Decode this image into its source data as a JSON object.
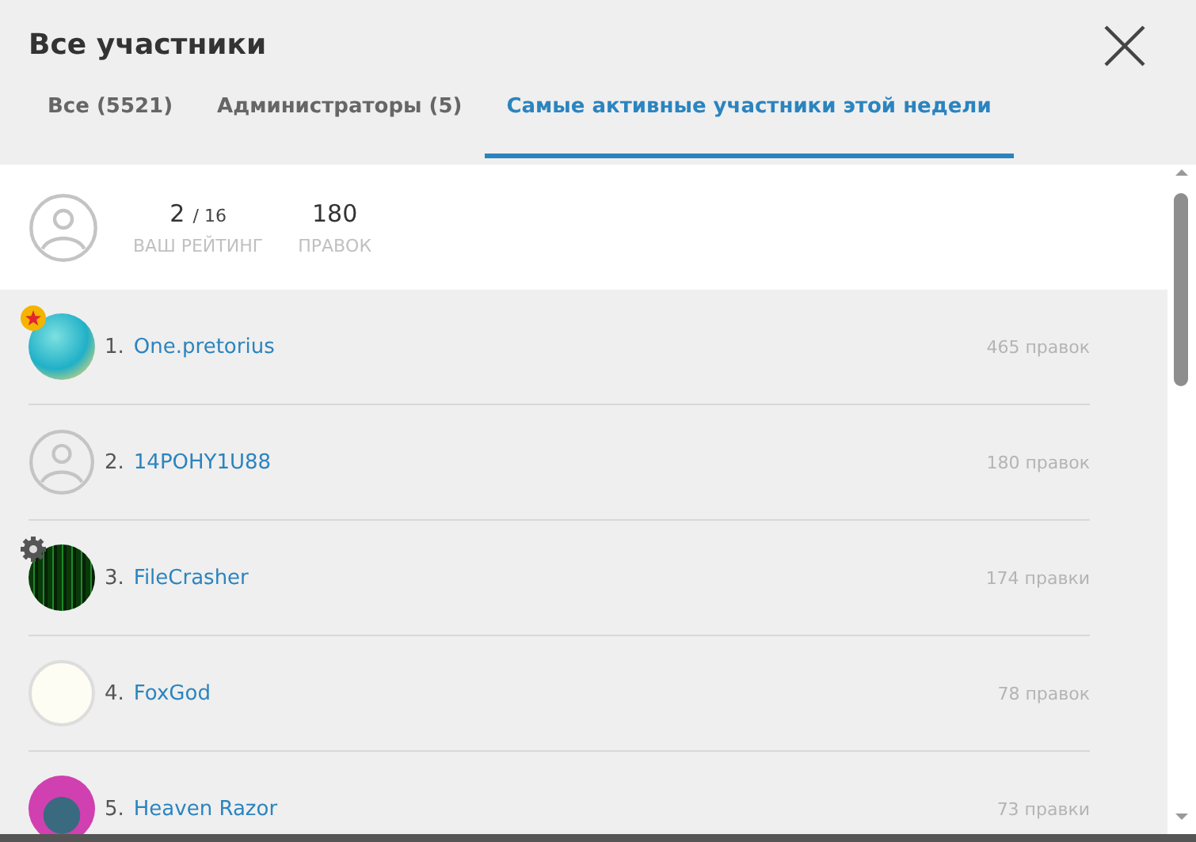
{
  "title": "Все участники",
  "tabs": [
    {
      "label": "Все (5521)",
      "selected": false
    },
    {
      "label": "Администраторы (5)",
      "selected": false
    },
    {
      "label": "Самые активные участники этой недели",
      "selected": true
    }
  ],
  "my_stats": {
    "rank": "2",
    "total": "/ 16",
    "rank_label": "ВАШ РЕЙТИНГ",
    "edits": "180",
    "edits_label": "ПРАВОК"
  },
  "members": [
    {
      "rank": "1.",
      "name": "One.pretorius",
      "edits": "465 правок",
      "avatar": {
        "kind": "photo"
      },
      "badge": {
        "kind": "star"
      }
    },
    {
      "rank": "2.",
      "name": "14POHY1U88",
      "edits": "180 правок",
      "avatar": {
        "kind": "default"
      }
    },
    {
      "rank": "3.",
      "name": "FileCrasher",
      "edits": "174 правки",
      "avatar": {
        "kind": "matrix"
      },
      "badge": {
        "kind": "gear"
      }
    },
    {
      "rank": "4.",
      "name": "FoxGod",
      "edits": "78 правок",
      "avatar": {
        "kind": "blank"
      }
    },
    {
      "rank": "5.",
      "name": "Heaven Razor",
      "edits": "73 правки",
      "avatar": {
        "kind": "person"
      }
    }
  ]
}
